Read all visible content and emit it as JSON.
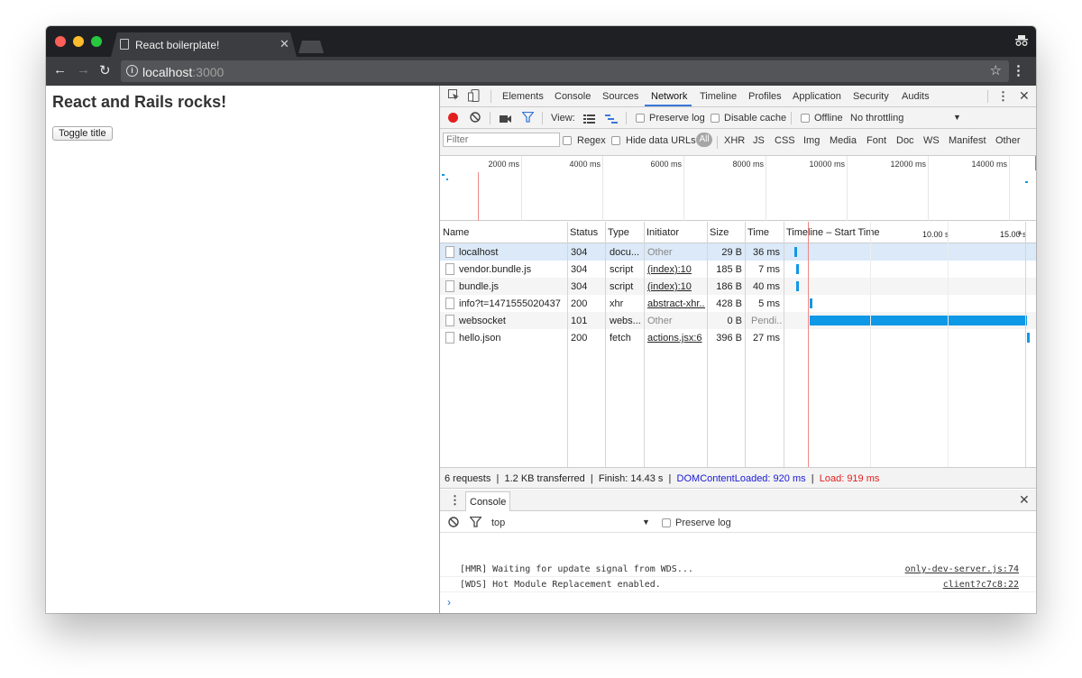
{
  "browser": {
    "tab_title": "React boilerplate!",
    "url_host": "localhost",
    "url_port": ":3000"
  },
  "page": {
    "heading": "React and Rails rocks!",
    "toggle_button": "Toggle title"
  },
  "devtools": {
    "tabs": [
      "Elements",
      "Console",
      "Sources",
      "Network",
      "Timeline",
      "Profiles",
      "Application",
      "Security",
      "Audits"
    ],
    "active_tab": "Network",
    "network_toolbar": {
      "view_label": "View:",
      "preserve_log": "Preserve log",
      "disable_cache": "Disable cache",
      "offline": "Offline",
      "throttling": "No throttling"
    },
    "filter_bar": {
      "filter_placeholder": "Filter",
      "regex": "Regex",
      "hide_data_urls": "Hide data URLs",
      "types": [
        "All",
        "XHR",
        "JS",
        "CSS",
        "Img",
        "Media",
        "Font",
        "Doc",
        "WS",
        "Manifest",
        "Other"
      ]
    },
    "overview_ticks": [
      "2000 ms",
      "4000 ms",
      "6000 ms",
      "8000 ms",
      "10000 ms",
      "12000 ms",
      "14000 ms"
    ],
    "columns": [
      "Name",
      "Status",
      "Type",
      "Initiator",
      "Size",
      "Time",
      "Timeline – Start Time"
    ],
    "timeline_ticks": [
      "10.00 s",
      "15.00 s"
    ],
    "requests": [
      {
        "name": "localhost",
        "status": "304",
        "type": "docu...",
        "initiator": "Other",
        "size": "29 B",
        "time": "36 ms"
      },
      {
        "name": "vendor.bundle.js",
        "status": "304",
        "type": "script",
        "initiator": "(index):10",
        "size": "185 B",
        "time": "7 ms"
      },
      {
        "name": "bundle.js",
        "status": "304",
        "type": "script",
        "initiator": "(index):10",
        "size": "186 B",
        "time": "40 ms"
      },
      {
        "name": "info?t=1471555020437",
        "status": "200",
        "type": "xhr",
        "initiator": "abstract-xhr....",
        "size": "428 B",
        "time": "5 ms"
      },
      {
        "name": "websocket",
        "status": "101",
        "type": "webs...",
        "initiator": "Other",
        "size": "0 B",
        "time": "Pendi..."
      },
      {
        "name": "hello.json",
        "status": "200",
        "type": "fetch",
        "initiator": "actions.jsx:6",
        "size": "396 B",
        "time": "27 ms"
      }
    ],
    "summary": {
      "requests": "6 requests",
      "transferred": "1.2 KB transferred",
      "finish": "Finish: 14.43 s",
      "dom_loaded": "DOMContentLoaded: 920 ms",
      "load": "Load: 919 ms",
      "sep": "|"
    },
    "console": {
      "drawer_tab": "Console",
      "context": "top",
      "preserve_log": "Preserve log",
      "messages": [
        {
          "text": "[HMR] Waiting for update signal from WDS...",
          "source": "only-dev-server.js:74"
        },
        {
          "text": "[WDS] Hot Module Replacement enabled.",
          "source": "client?c7c8:22"
        }
      ],
      "prompt": "›"
    }
  },
  "colors": {
    "accent_blue": "#0f98e5",
    "record_red": "#e31e1e",
    "dom_blue": "#1a1ad6"
  }
}
